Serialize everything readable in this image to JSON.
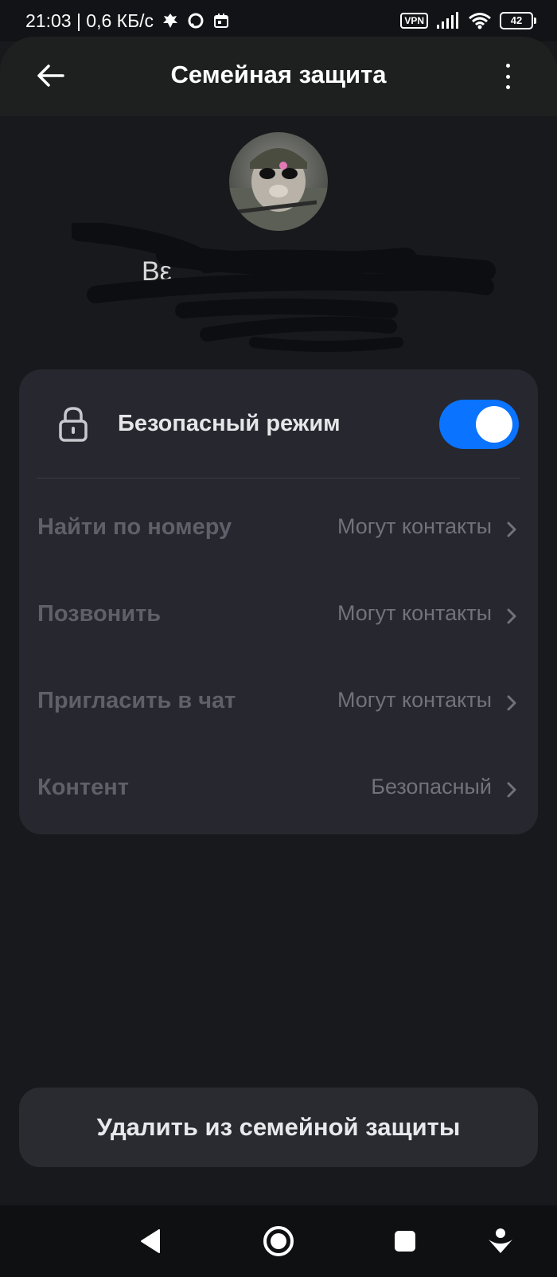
{
  "status_bar": {
    "time_speed": "21:03 | 0,6 КБ/с",
    "vpn_label": "VPN",
    "battery_level": "42"
  },
  "app_bar": {
    "title": "Семейная защита"
  },
  "profile": {
    "name_visible": "Bε"
  },
  "safe_mode": {
    "label": "Безопасный режим",
    "enabled": true,
    "accent_color": "#0a73ff"
  },
  "settings": [
    {
      "label": "Найти по номеру",
      "value": "Могут контакты"
    },
    {
      "label": "Позвонить",
      "value": "Могут контакты"
    },
    {
      "label": "Пригласить в чат",
      "value": "Могут контакты"
    },
    {
      "label": "Контент",
      "value": "Безопасный"
    }
  ],
  "actions": {
    "delete_label": "Удалить из семейной защиты"
  },
  "icons": {
    "back": "arrow-left-icon",
    "more": "more-vertical-icon",
    "lock": "lock-icon",
    "chevron": "chevron-right-icon"
  }
}
